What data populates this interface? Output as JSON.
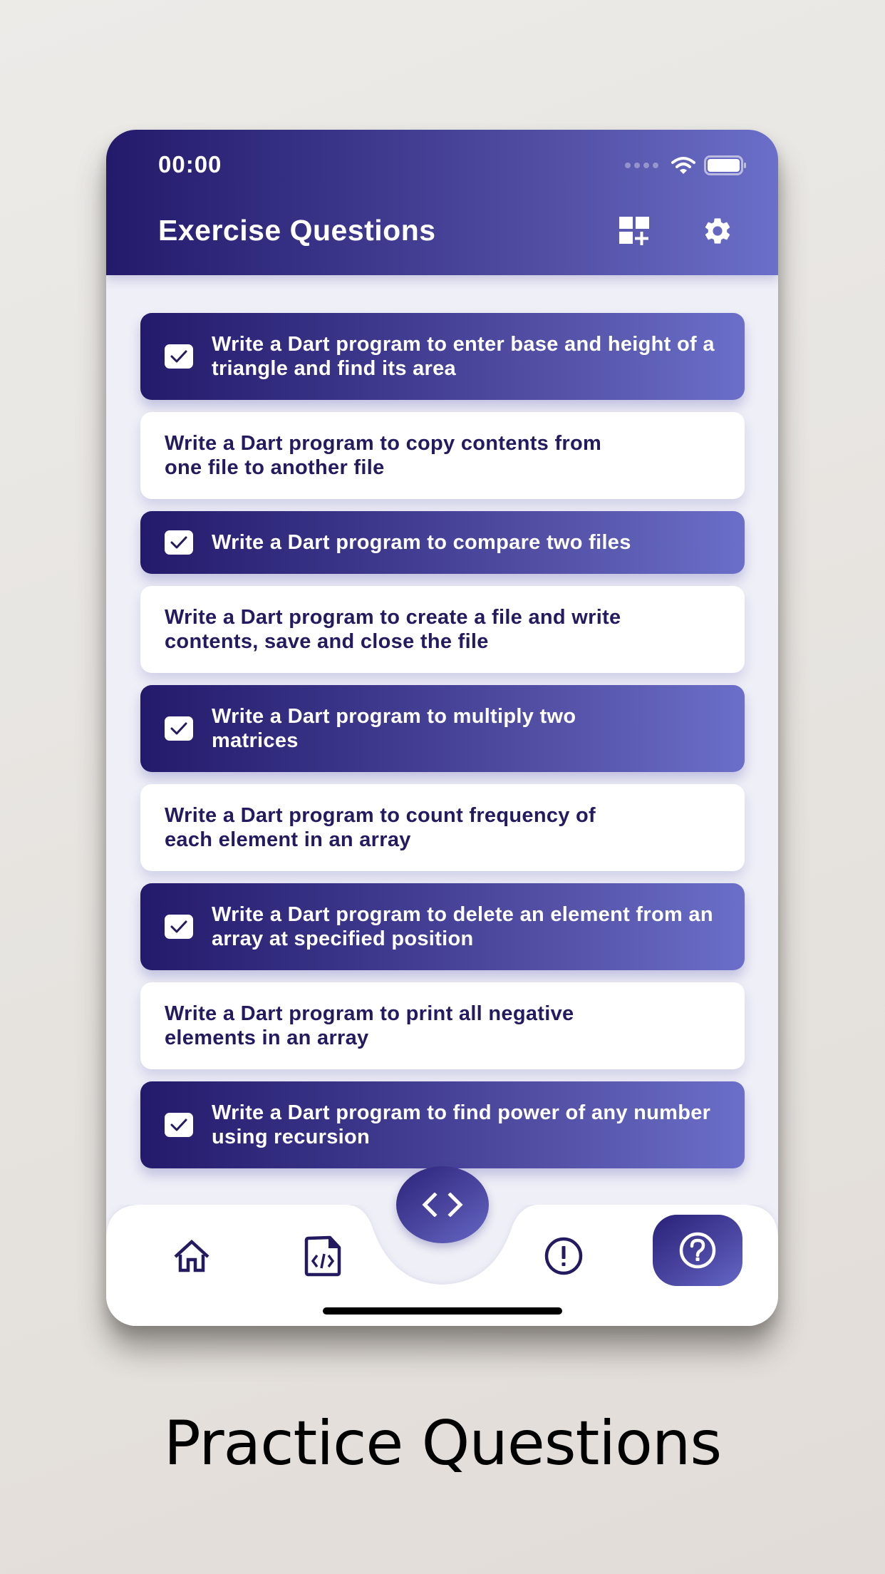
{
  "status_bar": {
    "time": "00:00",
    "icons": [
      "signal-dots-icon",
      "wifi-icon",
      "battery-icon"
    ]
  },
  "header": {
    "title": "Exercise Questions",
    "actions": [
      {
        "name": "add-widget",
        "icon": "grid-plus-icon"
      },
      {
        "name": "settings",
        "icon": "gear-icon"
      }
    ]
  },
  "questions": [
    {
      "text": "Write a Dart program to enter base and height of a triangle and find its area",
      "completed": true
    },
    {
      "text": "Write a Dart program to copy contents from one file to another file",
      "completed": false
    },
    {
      "text": "Write a Dart program to compare two files",
      "completed": true
    },
    {
      "text": "Write a Dart program to create a file and write contents, save and close the file",
      "completed": false
    },
    {
      "text": "Write a Dart program to multiply two matrices",
      "completed": true
    },
    {
      "text": "Write a Dart program to count frequency of each element in an array",
      "completed": false
    },
    {
      "text": "Write a Dart program to delete an element from an array at specified position",
      "completed": true
    },
    {
      "text": "Write a Dart program to print all negative elements in an array",
      "completed": false
    },
    {
      "text": "Write a Dart program to find power of any number using recursion",
      "completed": true
    }
  ],
  "bottom_nav": {
    "items": [
      {
        "name": "home",
        "icon": "home-icon",
        "active": false
      },
      {
        "name": "programs",
        "icon": "code-file-icon",
        "active": false
      },
      {
        "name": "code",
        "icon": "code-brackets-icon",
        "active": false,
        "floating": true
      },
      {
        "name": "info",
        "icon": "exclamation-circle-icon",
        "active": false
      },
      {
        "name": "questions",
        "icon": "question-circle-icon",
        "active": true
      }
    ]
  },
  "caption": "Practice Questions",
  "colors": {
    "primary_dark": "#241a6b",
    "primary_light": "#6b6fc9",
    "text_dark": "#231a5f",
    "card_bg": "#ffffff",
    "screen_bg": "#efeff7"
  }
}
